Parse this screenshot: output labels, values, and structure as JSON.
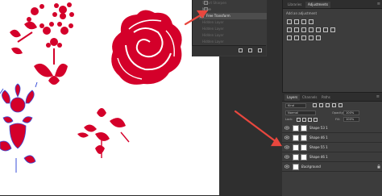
{
  "history": {
    "items": [
      {
        "label": "Smart Sharpen",
        "state": "dim"
      },
      {
        "label": "Move",
        "state": "normal"
      },
      {
        "label": "Free Transform",
        "state": "selected"
      },
      {
        "label": "Hidden Layer",
        "state": "dim"
      },
      {
        "label": "Hidden Layer",
        "state": "dim"
      },
      {
        "label": "Hidden Layer",
        "state": "dim"
      },
      {
        "label": "Hidden Layer",
        "state": "dim"
      }
    ]
  },
  "panels": {
    "tabs_top": [
      "Libraries",
      "Adjustments"
    ],
    "adjust_label": "Add an adjustment",
    "tabs_layers": [
      "Layers",
      "Channels",
      "Paths"
    ]
  },
  "layers_panel": {
    "kind": "Kind",
    "blend": "Normal",
    "opacity_label": "Opacity:",
    "opacity": "100%",
    "lock_label": "Lock:",
    "fill_label": "Fill:",
    "fill": "100%",
    "layers": [
      {
        "name": "Shape 53 1",
        "thumb": "shape"
      },
      {
        "name": "Shape 46 1",
        "thumb": "shape"
      },
      {
        "name": "Shape 55 1",
        "thumb": "shape"
      },
      {
        "name": "Shape 46 1",
        "thumb": "shape"
      },
      {
        "name": "Background",
        "thumb": "white"
      }
    ]
  },
  "colors": {
    "accent_red": "#d4002a",
    "arrow_red": "#e8473e",
    "panel_bg": "#3c3c3c",
    "canvas_bg": "#ffffff"
  }
}
